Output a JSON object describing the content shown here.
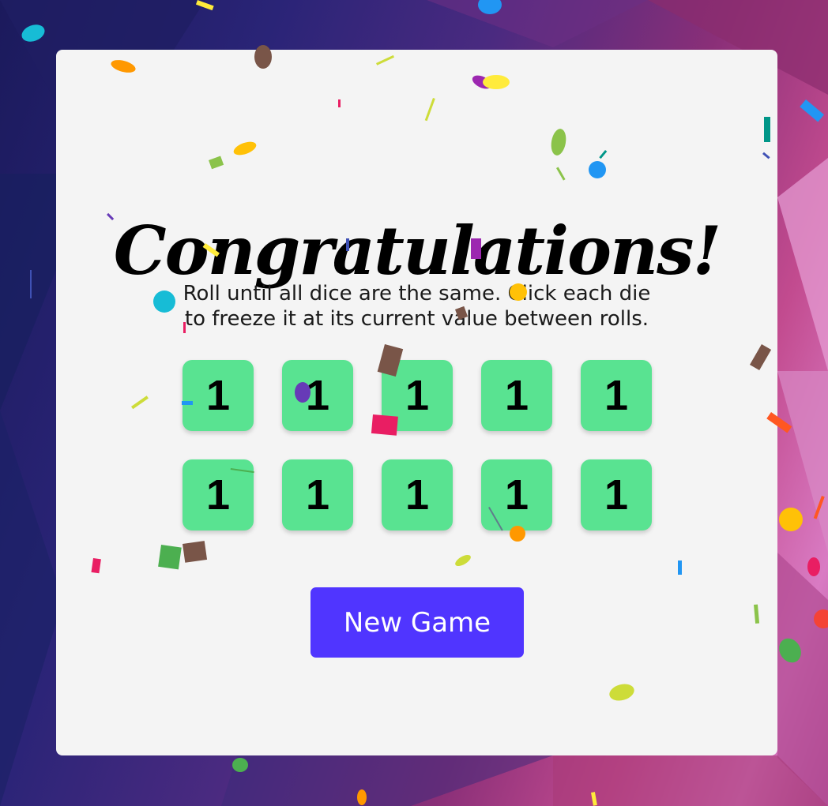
{
  "game": {
    "title": "Congratulations!",
    "instructions": "Roll until all dice are the same. Click each die to freeze it at its current value between rolls.",
    "dice": [
      "1",
      "1",
      "1",
      "1",
      "1",
      "1",
      "1",
      "1",
      "1",
      "1"
    ],
    "new_game_label": "New Game"
  },
  "colors": {
    "die": "#59e391",
    "button": "#5035ff",
    "card": "#f4f4f4"
  }
}
